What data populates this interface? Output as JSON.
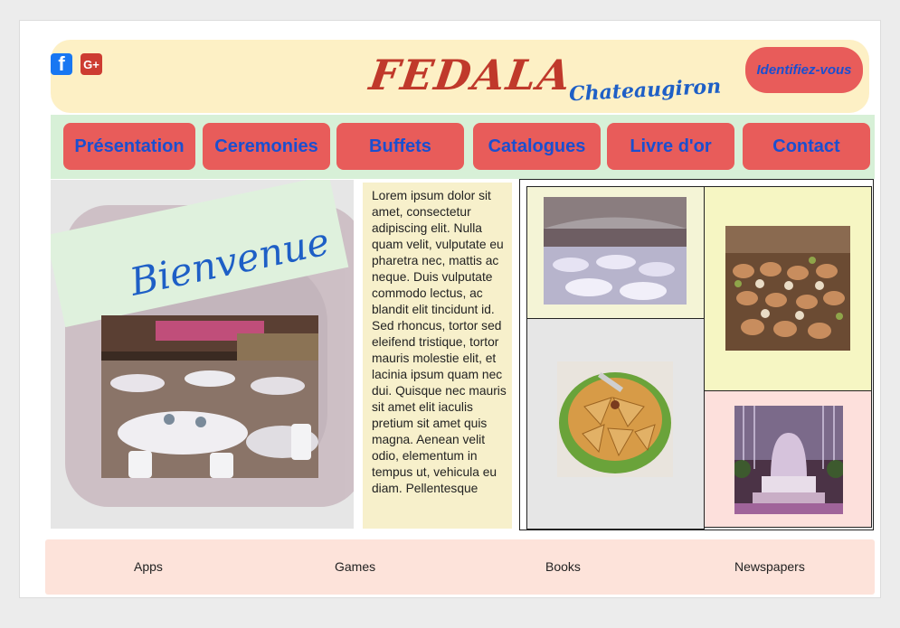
{
  "header": {
    "logo": "FEDALA",
    "subtitle": "Chateaugiron",
    "login_label": "Identifiez-vous",
    "social": [
      {
        "icon": "facebook-icon",
        "glyph": "f"
      },
      {
        "icon": "google-plus-icon",
        "glyph": "G+"
      }
    ]
  },
  "nav": {
    "items": [
      {
        "label": "Présentation"
      },
      {
        "label": "Ceremonies"
      },
      {
        "label": "Buffets"
      },
      {
        "label": "Catalogues"
      },
      {
        "label": "Livre d'or"
      },
      {
        "label": "Contact"
      }
    ]
  },
  "welcome": {
    "title": "Bienvenue"
  },
  "main": {
    "text": "Lorem ipsum dolor sit amet, consectetur adipiscing elit. Nulla quam velit, vulputate eu pharetra nec, mattis ac neque. Duis vulputate commodo lectus, ac blandit elit tincidunt id. Sed rhoncus, tortor sed eleifend tristique, tortor mauris molestie elit, et lacinia ipsum quam nec dui. Quisque nec mauris sit amet elit iaculis pretium sit amet quis magna. Aenean velit odio, elementum in tempus ut, vehicula eu diam. Pellentesque"
  },
  "footer": {
    "links": [
      {
        "label": "Apps"
      },
      {
        "label": "Games"
      },
      {
        "label": "Books"
      },
      {
        "label": "Newspapers"
      }
    ]
  },
  "colors": {
    "accent": "#e85c5a",
    "link_text": "#1a4fd0",
    "logo": "#c0392b",
    "header_bg": "#fdf0c5",
    "nav_bg": "#d7f0d7",
    "footer_bg": "#fde3da"
  }
}
